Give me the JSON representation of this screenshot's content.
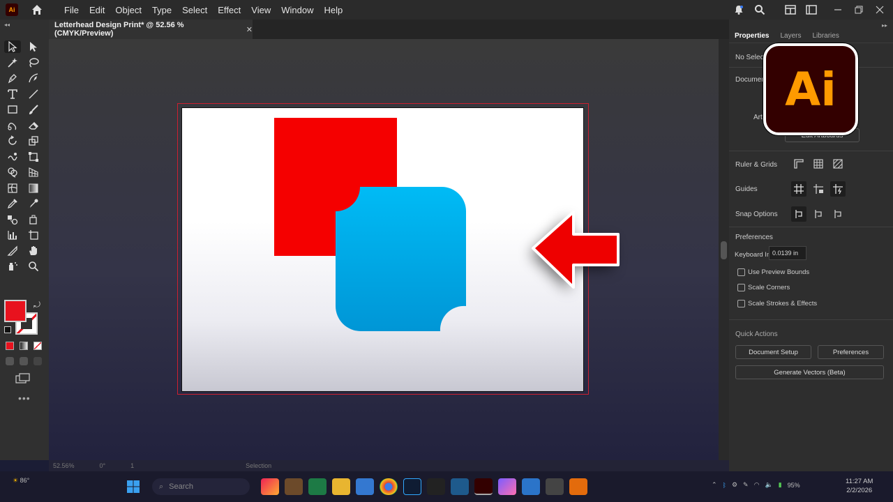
{
  "app": {
    "badge": "Ai",
    "menu": [
      "File",
      "Edit",
      "Object",
      "Type",
      "Select",
      "Effect",
      "View",
      "Window",
      "Help"
    ]
  },
  "document": {
    "tab_title": "Letterhead Design Print* @ 52.56 % (CMYK/Preview)",
    "close_glyph": "✕"
  },
  "status_bar": {
    "zoom": "52.56%",
    "rotation": "0°",
    "artboard": "1",
    "tool": "Selection"
  },
  "panel": {
    "tabs": [
      "Properties",
      "Layers",
      "Libraries"
    ],
    "no_selection": "No Selecti",
    "document_label": "Documen",
    "artboard_label": "Art",
    "edit_artboards": "Edit Artboards",
    "ruler_grids": "Ruler & Grids",
    "guides": "Guides",
    "snap_options": "Snap Options",
    "preferences_label": "Preferences",
    "keyboard_increment_label": "Keyboard Increment:",
    "keyboard_increment_value": "0.0139 in",
    "checkboxes": [
      "Use Preview Bounds",
      "Scale Corners",
      "Scale Strokes & Effects"
    ],
    "quick_actions_label": "Quick Actions",
    "document_setup_button": "Document Setup",
    "preferences_button": "Preferences",
    "generate_vectors_button": "Generate Vectors (Beta)"
  },
  "overlay_logo": "Ai",
  "taskbar": {
    "weather_temp": "86°",
    "search_placeholder": "Search",
    "battery": "95%",
    "time": "11:27 AM",
    "date": "2/2/2026"
  },
  "colors": {
    "fill": "#e8121e",
    "red_square": "#f50000",
    "blue_gradient_top": "#00bbf5",
    "blue_gradient_bottom": "#0096d6",
    "arrow": "#ee0000"
  }
}
